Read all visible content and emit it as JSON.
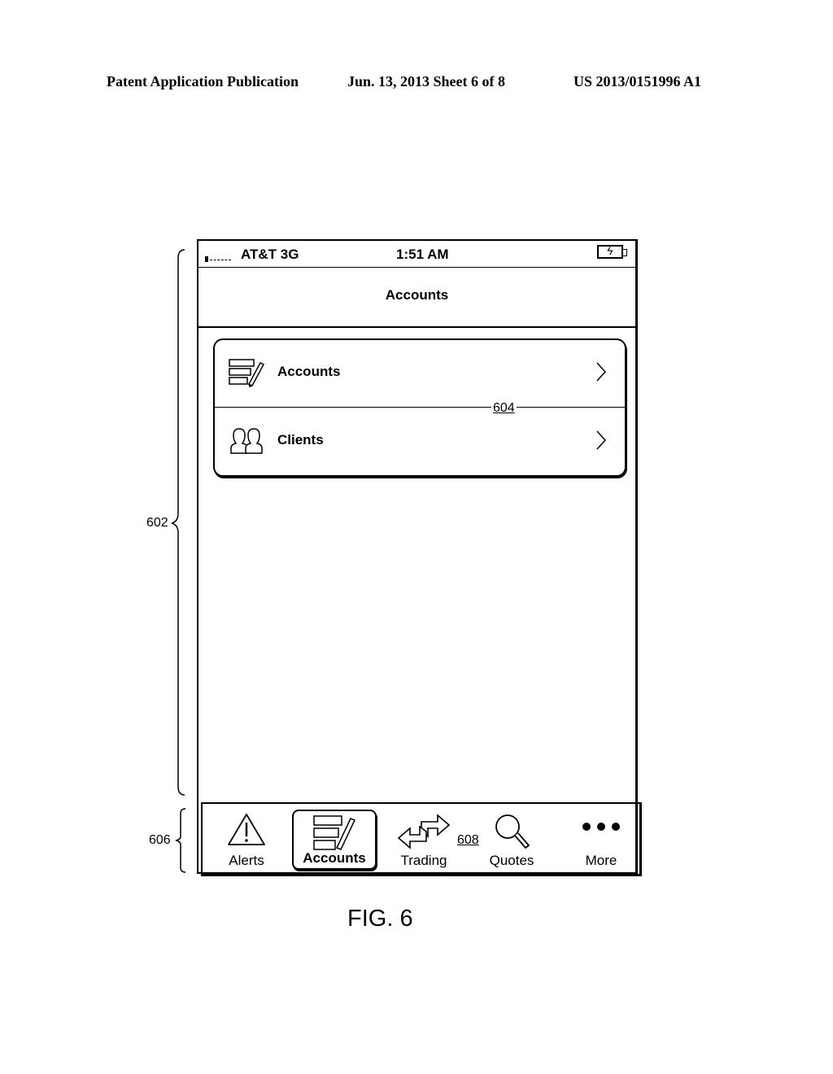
{
  "header": {
    "left": "Patent Application Publication",
    "middle": "Jun. 13, 2013  Sheet 6 of 8",
    "right": "US 2013/0151996 A1"
  },
  "status_bar": {
    "signal_icon": "signal-strength-icon",
    "carrier": "AT&T  3G",
    "time": "1:51 AM",
    "battery_icon": "battery-charging-icon"
  },
  "nav_bar": {
    "title": "Accounts"
  },
  "menu": {
    "items": [
      {
        "label": "Accounts",
        "icon": "accounts-edit-icon",
        "chevron": "chevron-right-icon"
      },
      {
        "label": "Clients",
        "icon": "clients-people-icon",
        "chevron": "chevron-right-icon"
      }
    ]
  },
  "tab_bar": {
    "items": [
      {
        "label": "Alerts",
        "icon": "alert-triangle-icon",
        "selected": false
      },
      {
        "label": "Accounts",
        "icon": "accounts-edit-icon",
        "selected": true
      },
      {
        "label": "Trading",
        "icon": "trade-arrows-icon",
        "selected": false
      },
      {
        "label": "Quotes",
        "icon": "magnifier-icon",
        "selected": false
      },
      {
        "label": "More",
        "icon": "more-dots-icon",
        "selected": false
      }
    ]
  },
  "reference_numerals": {
    "screen": "602",
    "menu_group": "604",
    "tab_bar": "606",
    "tab_item": "608"
  },
  "figure_label": "FIG. 6"
}
